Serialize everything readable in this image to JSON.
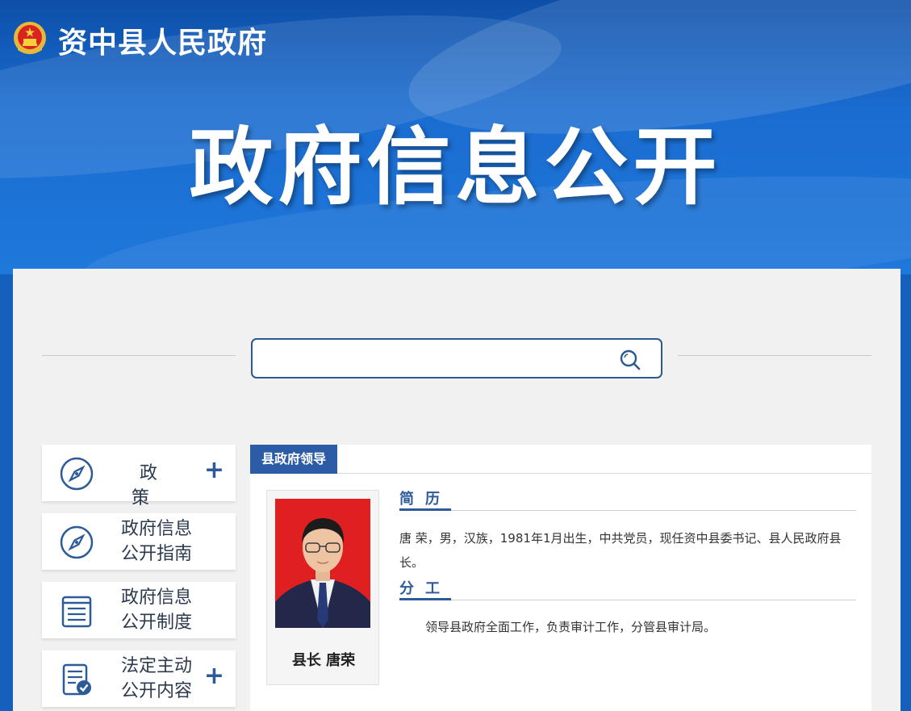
{
  "header": {
    "site_title": "资中县人民政府",
    "hero_title": "政府信息公开"
  },
  "search": {
    "placeholder": "",
    "value": ""
  },
  "sidebar": {
    "items": [
      {
        "label": "政策",
        "icon": "compass-icon",
        "has_plus": true
      },
      {
        "label_line1": "政府信息",
        "label_line2": "公开指南",
        "icon": "compass-icon",
        "has_plus": false
      },
      {
        "label_line1": "政府信息",
        "label_line2": "公开制度",
        "icon": "document-list-icon",
        "has_plus": false
      },
      {
        "label_line1": "法定主动",
        "label_line2": "公开内容",
        "icon": "document-check-icon",
        "has_plus": true
      }
    ],
    "plus_symbol": "+"
  },
  "content": {
    "tab_label": "县政府领导",
    "leader": {
      "caption": "县长  唐荣"
    },
    "sections": {
      "resume_title": "简历",
      "resume_text": "唐 荣，男，汉族，1981年1月出生，中共党员，现任资中县委书记、县人民政府县长。",
      "duty_title": "分工",
      "duty_text": "领导县政府全面工作，负责审计工作，分管县审计局。"
    }
  },
  "colors": {
    "banner_blue": "#1a6cd0",
    "accent_blue": "#2d5ca6",
    "panel_bg": "#f1f1f1",
    "photo_bg": "#e02020"
  }
}
